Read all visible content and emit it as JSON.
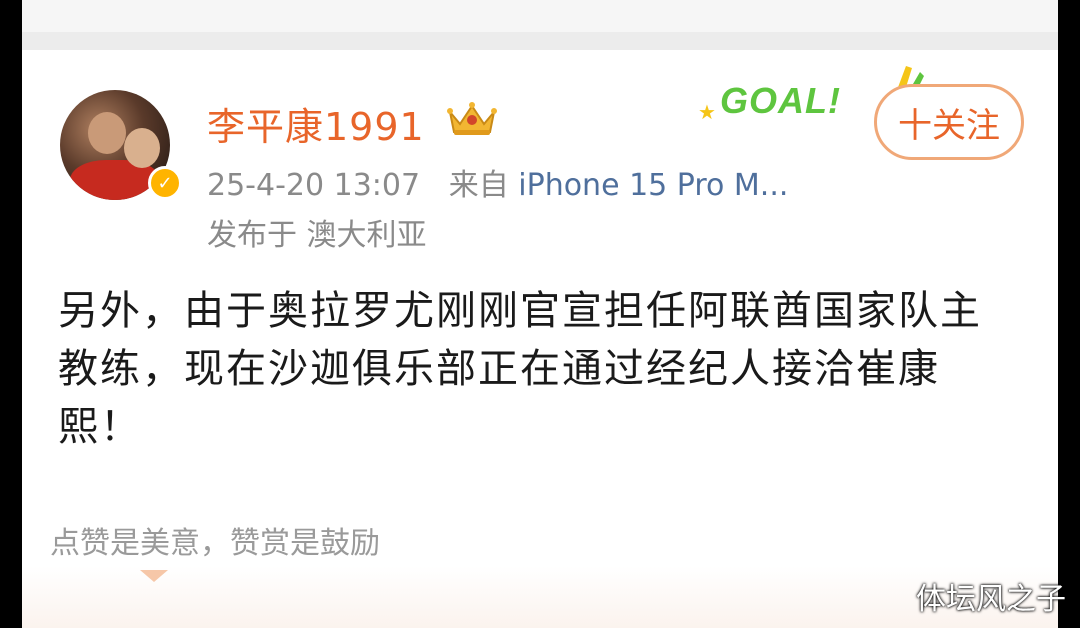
{
  "post": {
    "username": "李平康1991",
    "timestamp": "25-4-20 13:07",
    "source_prefix": "来自",
    "source": "iPhone 15 Pro M...",
    "location": "发布于 澳大利亚",
    "follow_label": "十关注",
    "badge_text": "GOAL!",
    "content": "另外，由于奥拉罗尤刚刚官宣担任阿联酋国家队主教练，现在沙迦俱乐部正在通过经纪人接洽崔康熙！",
    "reward_hint": "点赞是美意，赞赏是鼓励"
  },
  "icons": {
    "crown": "crown-icon",
    "verified": "verified-badge-icon",
    "star": "star-icon"
  },
  "colors": {
    "username": "#e8652a",
    "meta": "#8a8a8a",
    "source_link": "#4f6f9c",
    "follow_border": "#f0a878",
    "goal_green": "#5ec53f",
    "verified_gold": "#ffb400"
  },
  "watermark": "体坛风之子"
}
